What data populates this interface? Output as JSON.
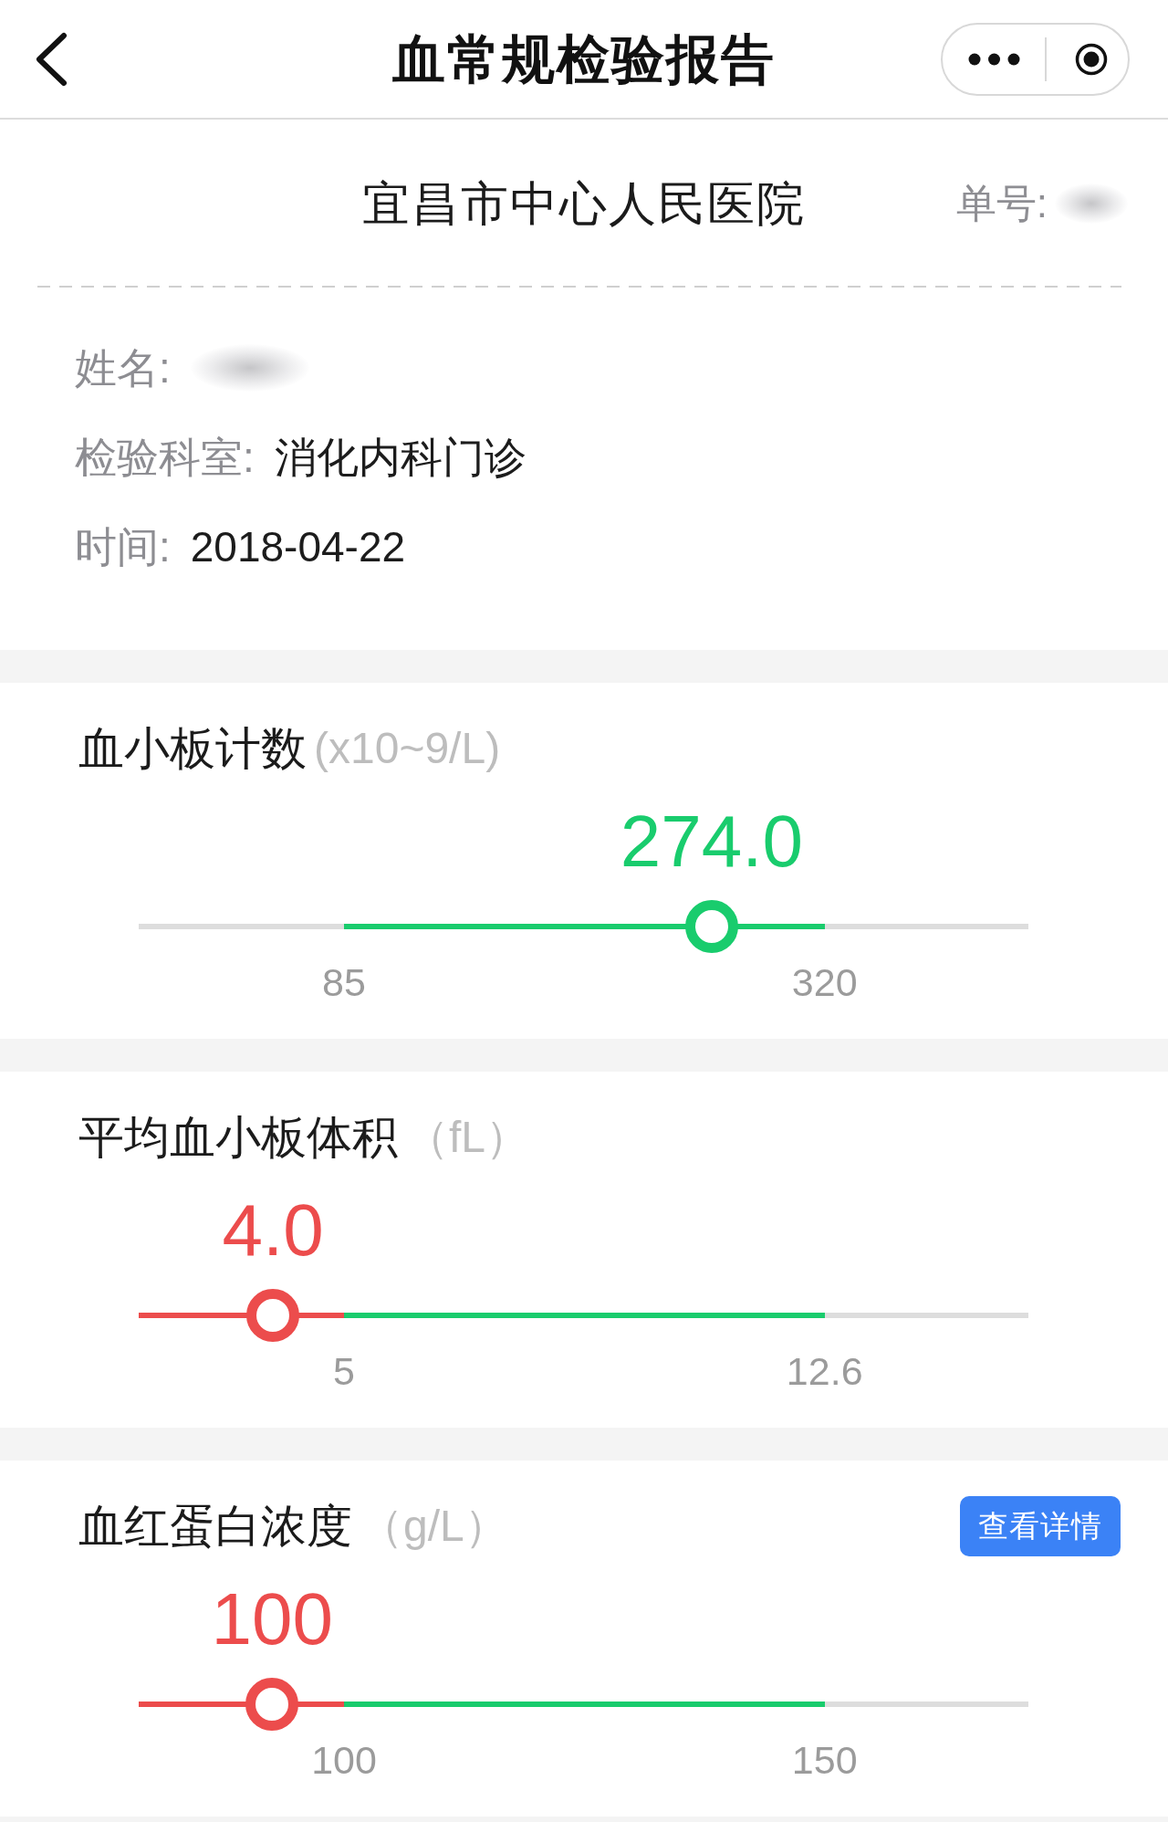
{
  "nav_bar": {
    "title": "血常规检验报告"
  },
  "report": {
    "hospital": "宜昌市中心人民医院",
    "order_number": {
      "label": "单号:",
      "redacted": true
    },
    "fields": [
      {
        "label": "姓名:",
        "redacted": true
      },
      {
        "label": "检验科室:",
        "value": "消化内科门诊",
        "redacted": false
      },
      {
        "label": "时间:",
        "value": "2018-04-22",
        "redacted": false
      }
    ]
  },
  "results": [
    {
      "name": "血小板计数",
      "unit": "(x10~9/L)",
      "value": "274.0",
      "abnormal": false,
      "level": 0.644,
      "range_low": "85",
      "range_high": "320"
    },
    {
      "name": "平均血小板体积",
      "unit": "（fL）",
      "value": "4.0",
      "abnormal": true,
      "level": 0.151,
      "range_low": "5",
      "range_high": "12.6"
    },
    {
      "name": "血红蛋白浓度",
      "unit": "（g/L）",
      "value": "100",
      "abnormal": true,
      "level": 0.15,
      "range_low": "100",
      "range_high": "150",
      "action": "查看详情"
    }
  ]
}
